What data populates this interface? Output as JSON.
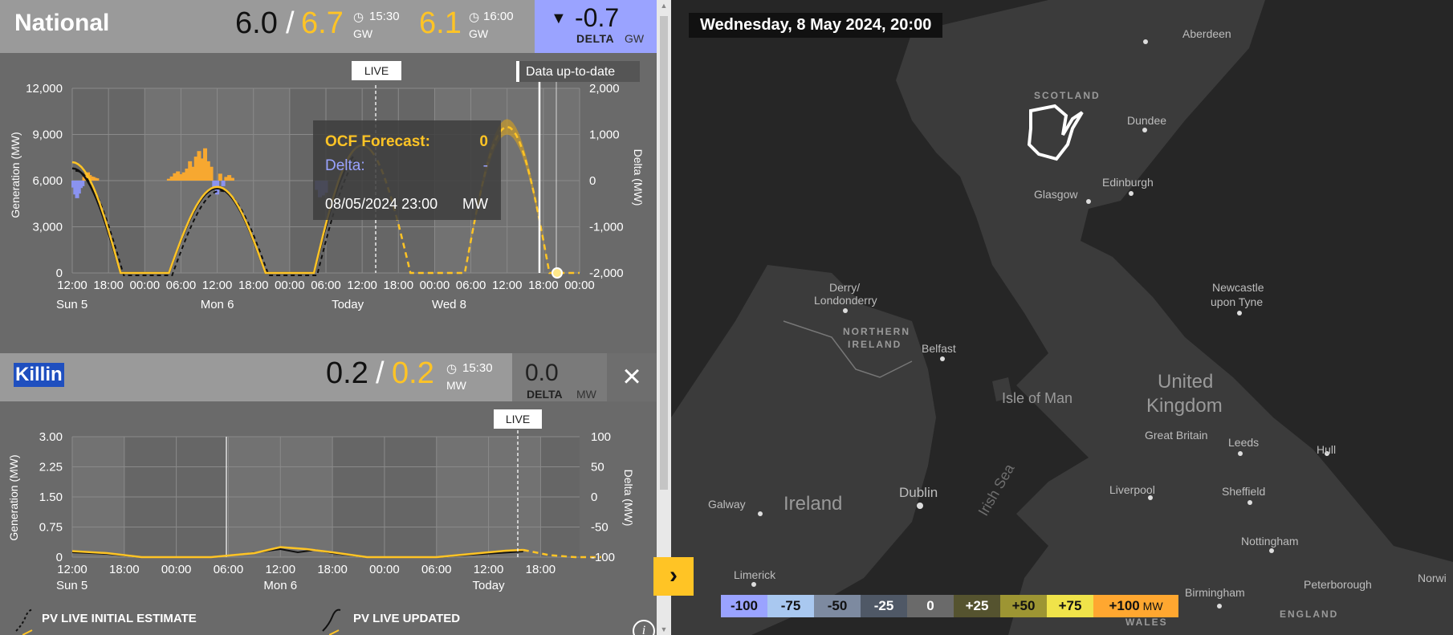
{
  "national": {
    "title": "National",
    "actual": "6.0",
    "slash": "/",
    "forecast": "6.7",
    "time1": "15:30",
    "unit1": "GW",
    "next_forecast": "6.1",
    "time2": "16:00",
    "unit2": "GW",
    "delta_arrow": "▼",
    "delta_value": "-0.7",
    "delta_label": "DELTA",
    "delta_unit": "GW"
  },
  "chart1": {
    "live_tag": "LIVE",
    "data_tag": "Data up-to-date",
    "y_left_label": "Generation (MW)",
    "y_right_label": "Delta (MW)",
    "y_left_ticks": [
      "12,000",
      "9,000",
      "6,000",
      "3,000",
      "0"
    ],
    "y_right_ticks": [
      "2,000",
      "1,000",
      "0",
      "-1,000",
      "-2,000"
    ],
    "x_ticks": [
      "12:00",
      "18:00",
      "00:00",
      "06:00",
      "12:00",
      "18:00",
      "00:00",
      "06:00",
      "12:00",
      "18:00",
      "00:00",
      "06:00",
      "12:00",
      "18:00",
      "00:00"
    ],
    "x_day_labels": [
      "Sun 5",
      "Mon 6",
      "Today",
      "Wed 8"
    ],
    "tooltip": {
      "forecast_label": "OCF Forecast:",
      "forecast_value": "0",
      "delta_label": "Delta:",
      "delta_value": "-",
      "datetime": "08/05/2024 23:00",
      "unit": "MW"
    }
  },
  "killin": {
    "title": "Killin",
    "actual": "0.2",
    "slash": "/",
    "forecast": "0.2",
    "time": "15:30",
    "unit": "MW",
    "delta_value": "0.0",
    "delta_label": "DELTA",
    "delta_unit": "MW",
    "close_icon": "×"
  },
  "chart2": {
    "live_tag": "LIVE",
    "y_left_label": "Generation (MW)",
    "y_right_label": "Delta (MW)",
    "y_left_ticks": [
      "3.00",
      "2.25",
      "1.50",
      "0.75",
      "0"
    ],
    "y_right_ticks": [
      "100",
      "50",
      "0",
      "-50",
      "-100"
    ],
    "x_ticks": [
      "12:00",
      "18:00",
      "00:00",
      "06:00",
      "12:00",
      "18:00",
      "00:00",
      "06:00",
      "12:00",
      "18:00"
    ],
    "x_day_labels": [
      "Sun 5",
      "Mon 6",
      "Today"
    ]
  },
  "legend": {
    "initial": "PV LIVE INITIAL ESTIMATE",
    "updated": "PV LIVE UPDATED",
    "info": "i"
  },
  "expand_icon": "›",
  "map": {
    "date": "Wednesday, 8 May 2024, 20:00",
    "legend": [
      {
        "label": "-100",
        "color": "#9aa3ff",
        "text": "#111"
      },
      {
        "label": "-75",
        "color": "#a9c8f0",
        "text": "#111"
      },
      {
        "label": "-50",
        "color": "#7d8aa0",
        "text": "#111"
      },
      {
        "label": "-25",
        "color": "#4f5866",
        "text": "#fff"
      },
      {
        "label": "0",
        "color": "#6a6a6a",
        "text": "#fff"
      },
      {
        "label": "+25",
        "color": "#55532f",
        "text": "#fff"
      },
      {
        "label": "+50",
        "color": "#9d9533",
        "text": "#111"
      },
      {
        "label": "+75",
        "color": "#f0e34a",
        "text": "#111"
      },
      {
        "label": "+100",
        "color": "#ffa730",
        "text": "#111"
      }
    ],
    "legend_unit": "MW",
    "places": {
      "aberdeen": "Aberdeen",
      "scotland": "SCOTLAND",
      "dundee": "Dundee",
      "edinburgh": "Edinburgh",
      "glasgow": "Glasgow",
      "derry": "Derry/",
      "londonderry": "Londonderry",
      "northern": "NORTHERN",
      "ireland_region": "IRELAND",
      "belfast": "Belfast",
      "isle_of_man": "Isle of Man",
      "newcastle1": "Newcastle",
      "newcastle2": "upon Tyne",
      "united": "United",
      "kingdom": "Kingdom",
      "great_britain": "Great Britain",
      "leeds": "Leeds",
      "hull": "Hull",
      "galway": "Galway",
      "ireland": "Ireland",
      "dublin": "Dublin",
      "irish_sea": "Irish Sea",
      "liverpool": "Liverpool",
      "sheffield": "Sheffield",
      "limerick": "Limerick",
      "nottingham": "Nottingham",
      "birmingham": "Birmingham",
      "peterborough": "Peterborough",
      "norwich": "Norwi",
      "england": "ENGLAND",
      "wales": "WALES"
    }
  }
}
